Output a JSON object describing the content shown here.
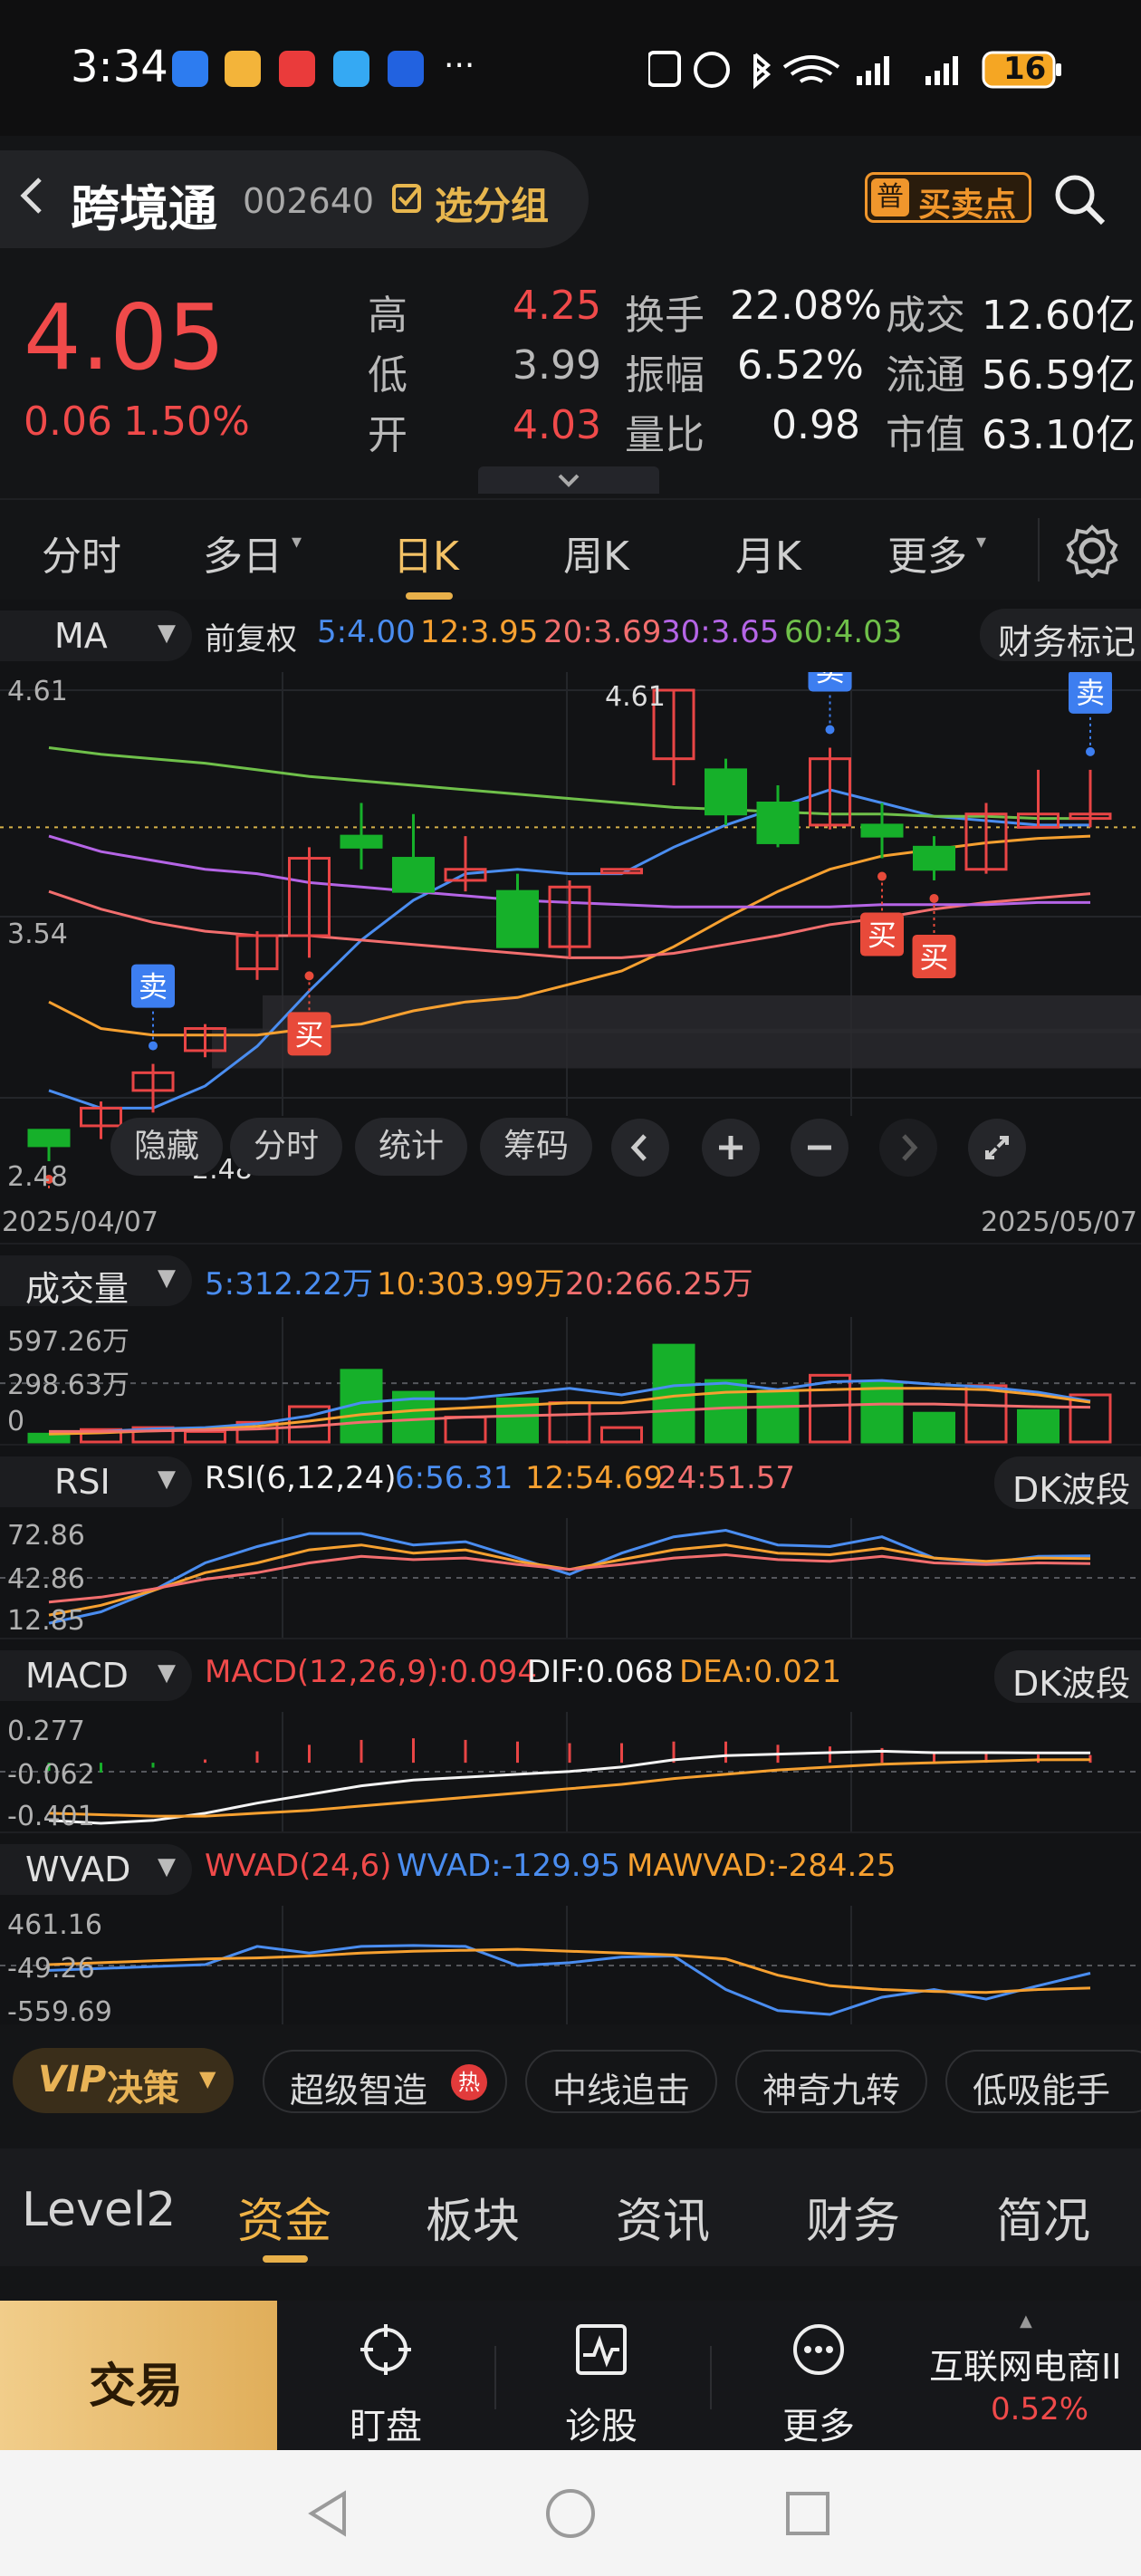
{
  "status_bar": {
    "time": "3:34",
    "app_icons": [
      "app-icon-1",
      "weibo-icon",
      "app-icon-3",
      "app-icon-4",
      "app-icon-5"
    ],
    "more": "···",
    "battery": "16"
  },
  "header": {
    "back_label": "<",
    "stock_name": "跨境通",
    "stock_code": "002640",
    "group_label": "选分组",
    "trade_point_badge": "普",
    "trade_point_label": "买卖点"
  },
  "quote": {
    "price": "4.05",
    "change": "0.06",
    "change_pct": "1.50%",
    "high_label": "高",
    "high": "4.25",
    "low_label": "低",
    "low": "3.99",
    "open_label": "开",
    "open": "4.03",
    "turnover_label": "换手",
    "turnover": "22.08%",
    "amplitude_label": "振幅",
    "amplitude": "6.52%",
    "volume_ratio_label": "量比",
    "volume_ratio": "0.98",
    "amount_label": "成交",
    "amount": "12.60亿",
    "float_label": "流通",
    "float_cap": "56.59亿",
    "mktcap_label": "市值",
    "mktcap": "63.10亿",
    "expand_icon": "chevron-down-icon"
  },
  "tabs": {
    "items": [
      "分时",
      "多日",
      "日K",
      "周K",
      "月K",
      "更多"
    ],
    "active": "日K",
    "settings_icon": "gear-icon"
  },
  "kline": {
    "indicator": "MA",
    "adjust": "前复权",
    "ma5": "5:4.00",
    "ma12": "12:3.95",
    "ma20": "20:3.69",
    "ma30": "30:3.65",
    "ma60": "60:4.03",
    "finance_mark": "财务标记",
    "y_top": "4.61",
    "y_mid": "3.54",
    "y_bottom": "2.48",
    "high_marker": "4.61",
    "low_marker": "2.48",
    "date_start": "2025/04/07",
    "date_end": "2025/05/07",
    "buy_label": "买",
    "sell_label": "卖",
    "tools": [
      "隐藏",
      "分时",
      "统计",
      "筹码"
    ],
    "colors": {
      "up": "#e84545",
      "down": "#16b02a",
      "ma5": "#4a8df0",
      "ma12": "#f6a030",
      "ma20": "#f26e6e",
      "ma30": "#b565e6",
      "ma60": "#6fc04a"
    }
  },
  "chart_data": [
    {
      "type": "candlestick",
      "title": "日K",
      "x": [
        "2025/04/07",
        "",
        "",
        "",
        "",
        "",
        "",
        "",
        "",
        "",
        "",
        "",
        "",
        "",
        "",
        "",
        "",
        "",
        "",
        "",
        "2025/05/07"
      ],
      "ohlc": [
        [
          2.62,
          2.62,
          2.48,
          2.55
        ],
        [
          2.64,
          2.75,
          2.58,
          2.72
        ],
        [
          2.8,
          2.92,
          2.7,
          2.88
        ],
        [
          2.98,
          3.1,
          2.95,
          3.08
        ],
        [
          3.35,
          3.52,
          3.3,
          3.5
        ],
        [
          3.5,
          3.9,
          3.4,
          3.85
        ],
        [
          3.95,
          4.1,
          3.8,
          3.9
        ],
        [
          3.85,
          4.05,
          3.7,
          3.7
        ],
        [
          3.75,
          3.95,
          3.7,
          3.8
        ],
        [
          3.7,
          3.78,
          3.45,
          3.45
        ],
        [
          3.45,
          3.75,
          3.4,
          3.72
        ],
        [
          3.8,
          3.8,
          3.8,
          3.8
        ],
        [
          4.3,
          4.61,
          4.18,
          4.61
        ],
        [
          4.25,
          4.3,
          4.0,
          4.05
        ],
        [
          4.1,
          4.18,
          3.9,
          3.92
        ],
        [
          4.0,
          4.35,
          3.98,
          4.3
        ],
        [
          4.0,
          4.1,
          3.85,
          3.95
        ],
        [
          3.9,
          3.95,
          3.75,
          3.8
        ],
        [
          3.8,
          4.1,
          3.78,
          4.05
        ],
        [
          3.99,
          4.25,
          3.99,
          4.05
        ],
        [
          4.03,
          4.25,
          3.99,
          4.05
        ]
      ],
      "ma": {
        "MA5": [
          2.8,
          2.72,
          2.72,
          2.82,
          3.0,
          3.25,
          3.48,
          3.66,
          3.78,
          3.8,
          3.78,
          3.78,
          3.9,
          4.0,
          4.08,
          4.16,
          4.1,
          4.04,
          4.02,
          4.0,
          4.0
        ],
        "MA12": [
          3.2,
          3.08,
          3.05,
          3.05,
          3.05,
          3.08,
          3.1,
          3.16,
          3.2,
          3.22,
          3.28,
          3.34,
          3.45,
          3.58,
          3.7,
          3.8,
          3.86,
          3.89,
          3.92,
          3.94,
          3.95
        ],
        "MA20": [
          3.7,
          3.62,
          3.56,
          3.52,
          3.5,
          3.5,
          3.48,
          3.46,
          3.44,
          3.42,
          3.4,
          3.4,
          3.42,
          3.46,
          3.5,
          3.55,
          3.58,
          3.62,
          3.65,
          3.67,
          3.69
        ],
        "MA30": [
          3.95,
          3.88,
          3.84,
          3.8,
          3.78,
          3.74,
          3.72,
          3.7,
          3.68,
          3.66,
          3.65,
          3.64,
          3.63,
          3.63,
          3.63,
          3.63,
          3.64,
          3.64,
          3.64,
          3.65,
          3.65
        ],
        "MA60": [
          4.35,
          4.32,
          4.3,
          4.28,
          4.25,
          4.22,
          4.2,
          4.18,
          4.16,
          4.14,
          4.12,
          4.1,
          4.08,
          4.07,
          4.06,
          4.05,
          4.05,
          4.04,
          4.04,
          4.03,
          4.03
        ]
      },
      "signals": [
        {
          "index": 0,
          "type": "买"
        },
        {
          "index": 2,
          "type": "卖"
        },
        {
          "index": 5,
          "type": "买"
        },
        {
          "index": 15,
          "type": "卖"
        },
        {
          "index": 16,
          "type": "买"
        },
        {
          "index": 17,
          "type": "买"
        },
        {
          "index": 20,
          "type": "卖"
        }
      ],
      "ylim": [
        2.48,
        4.61
      ],
      "reference_line": 3.99
    },
    {
      "type": "bar",
      "title": "成交量",
      "values": [
        60,
        95,
        110,
        80,
        150,
        270,
        548,
        380,
        190,
        330,
        300,
        110,
        740,
        470,
        390,
        510,
        450,
        220,
        430,
        240,
        360
      ],
      "up": [
        false,
        true,
        true,
        true,
        true,
        true,
        false,
        false,
        true,
        false,
        true,
        true,
        false,
        false,
        false,
        true,
        false,
        false,
        true,
        false,
        true
      ],
      "series": [
        {
          "name": "5",
          "values": [
            70,
            80,
            100,
            110,
            140,
            200,
            300,
            330,
            330,
            370,
            410,
            360,
            430,
            450,
            400,
            460,
            470,
            440,
            420,
            380,
            312
          ]
        },
        {
          "name": "10",
          "values": [
            60,
            70,
            85,
            95,
            120,
            160,
            210,
            240,
            260,
            280,
            300,
            300,
            350,
            380,
            390,
            400,
            410,
            410,
            400,
            360,
            304
          ]
        },
        {
          "name": "20",
          "values": [
            80,
            80,
            85,
            90,
            100,
            120,
            150,
            170,
            190,
            200,
            210,
            220,
            240,
            260,
            270,
            280,
            290,
            290,
            280,
            270,
            266
          ]
        }
      ],
      "ylim": [
        0,
        900
      ],
      "ticks": [
        "597.26万",
        "298.63万",
        "0"
      ]
    },
    {
      "type": "line",
      "title": "RSI",
      "series": [
        {
          "name": "6",
          "values": [
            15,
            22,
            35,
            52,
            62,
            70,
            70,
            63,
            65,
            55,
            45,
            58,
            68,
            72,
            63,
            62,
            68,
            55,
            52,
            56,
            56.31
          ]
        },
        {
          "name": "12",
          "values": [
            20,
            26,
            35,
            46,
            52,
            60,
            63,
            58,
            60,
            53,
            48,
            54,
            60,
            63,
            58,
            57,
            61,
            55,
            53,
            55,
            54.69
          ]
        },
        {
          "name": "24",
          "values": [
            28,
            31,
            36,
            42,
            46,
            52,
            56,
            54,
            55,
            51,
            48,
            51,
            55,
            57,
            54,
            53,
            56,
            52,
            51,
            52,
            51.57
          ]
        }
      ],
      "ylim": [
        12.85,
        72.86
      ],
      "ticks": [
        "72.86",
        "42.86",
        "12.85"
      ]
    },
    {
      "type": "line",
      "title": "MACD(12,26,9)",
      "series": [
        {
          "name": "DIF",
          "values": [
            -0.4,
            -0.42,
            -0.4,
            -0.35,
            -0.28,
            -0.22,
            -0.16,
            -0.12,
            -0.1,
            -0.08,
            -0.06,
            -0.03,
            0.02,
            0.05,
            0.06,
            0.07,
            0.08,
            0.07,
            0.07,
            0.068,
            0.068
          ]
        },
        {
          "name": "DEA",
          "values": [
            -0.35,
            -0.36,
            -0.37,
            -0.37,
            -0.35,
            -0.33,
            -0.3,
            -0.27,
            -0.24,
            -0.21,
            -0.18,
            -0.15,
            -0.11,
            -0.08,
            -0.05,
            -0.03,
            -0.01,
            0.0,
            0.01,
            0.02,
            0.021
          ]
        },
        {
          "name": "MACD",
          "values": [
            -0.1,
            -0.12,
            -0.06,
            0.04,
            0.14,
            0.22,
            0.28,
            0.3,
            0.28,
            0.26,
            0.24,
            0.24,
            0.26,
            0.26,
            0.22,
            0.2,
            0.18,
            0.14,
            0.12,
            0.1,
            0.094
          ]
        }
      ],
      "ylim": [
        -0.401,
        0.277
      ],
      "ticks": [
        "0.277",
        "-0.062",
        "-0.401"
      ]
    },
    {
      "type": "line",
      "title": "WVAD(24,6)",
      "series": [
        {
          "name": "WVAD",
          "values": [
            -100,
            -80,
            -60,
            -40,
            150,
            80,
            150,
            160,
            150,
            -50,
            -20,
            40,
            50,
            -300,
            -520,
            -560,
            -380,
            -300,
            -400,
            -260,
            -129.95
          ]
        },
        {
          "name": "MAWVAD",
          "values": [
            -40,
            -20,
            0,
            20,
            30,
            50,
            80,
            100,
            110,
            120,
            100,
            80,
            60,
            20,
            -150,
            -260,
            -300,
            -320,
            -330,
            -300,
            -284.25
          ]
        }
      ],
      "ylim": [
        -559.69,
        461.16
      ],
      "ticks": [
        "461.16",
        "-49.26",
        "-559.69"
      ]
    }
  ],
  "volume_panel": {
    "label": "成交量",
    "ma5": "5:312.22万",
    "ma10": "10:303.99万",
    "ma20": "20:266.25万",
    "t1": "597.26万",
    "t2": "298.63万",
    "t3": "0"
  },
  "rsi_panel": {
    "label": "RSI",
    "params": "RSI(6,12,24)",
    "r6": "6:56.31",
    "r12": "12:54.69",
    "r24": "24:51.57",
    "pill": "DK波段",
    "t1": "72.86",
    "t2": "42.86",
    "t3": "12.85"
  },
  "macd_panel": {
    "label": "MACD",
    "macd": "MACD(12,26,9):0.094",
    "dif": "DIF:0.068",
    "dea": "DEA:0.021",
    "pill": "DK波段",
    "t1": "0.277",
    "t2": "-0.062",
    "t3": "-0.401"
  },
  "wvad_panel": {
    "label": "WVAD",
    "params": "WVAD(24,6)",
    "wvad": "WVAD:-129.95",
    "mawvad": "MAWVAD:-284.25",
    "t1": "461.16",
    "t2": "-49.26",
    "t3": "-559.69"
  },
  "strategies": {
    "vip_prefix": "VIP",
    "vip_label": "决策",
    "items": [
      "超级智造",
      "中线追击",
      "神奇九转",
      "低吸能手"
    ],
    "hot_badge": "热"
  },
  "bottom_tabs": {
    "items": [
      "Level2",
      "资金",
      "板块",
      "资讯",
      "财务",
      "简况"
    ],
    "active": "资金"
  },
  "actions": {
    "trade": "交易",
    "watch": "盯盘",
    "diagnose": "诊股",
    "more": "更多",
    "sector_name": "互联网电商II",
    "sector_pct": "0.52%"
  }
}
